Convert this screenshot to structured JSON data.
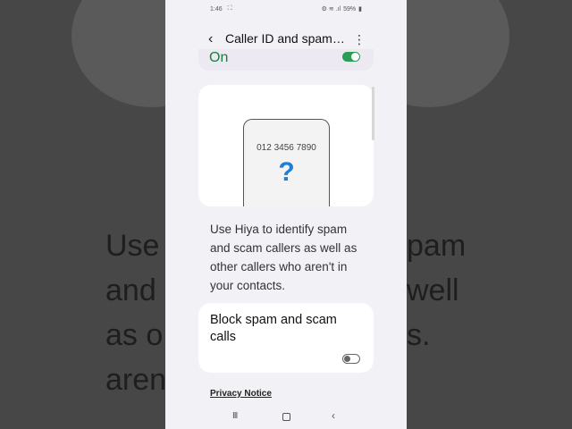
{
  "status_bar": {
    "time": "1:46",
    "left_icons": "⛶",
    "right_icons": "⚙ ≋ .ıl",
    "battery": "59%"
  },
  "header": {
    "back_icon": "‹",
    "title": "Caller ID and spam…",
    "more_icon": "⋮"
  },
  "master_switch": {
    "label": "On",
    "state": "on"
  },
  "illustration": {
    "number": "012 3456 7890",
    "question": "?"
  },
  "description": "Use Hiya to identify spam and scam callers as well as other callers who aren't in your contacts.",
  "block_option": {
    "label": "Block spam and scam calls",
    "state": "off"
  },
  "privacy_link": "Privacy Notice",
  "nav": {
    "recents_icon": "III",
    "back_icon": "‹"
  },
  "background": {
    "left_text_lines": [
      "Use",
      "and",
      "as o",
      "aren"
    ],
    "right_text_lines": [
      "pam",
      "well",
      "",
      "s."
    ]
  },
  "colors": {
    "accent_green": "#1a7f3d",
    "toggle_green": "#2a9d57",
    "question_blue": "#1f7fd6"
  }
}
